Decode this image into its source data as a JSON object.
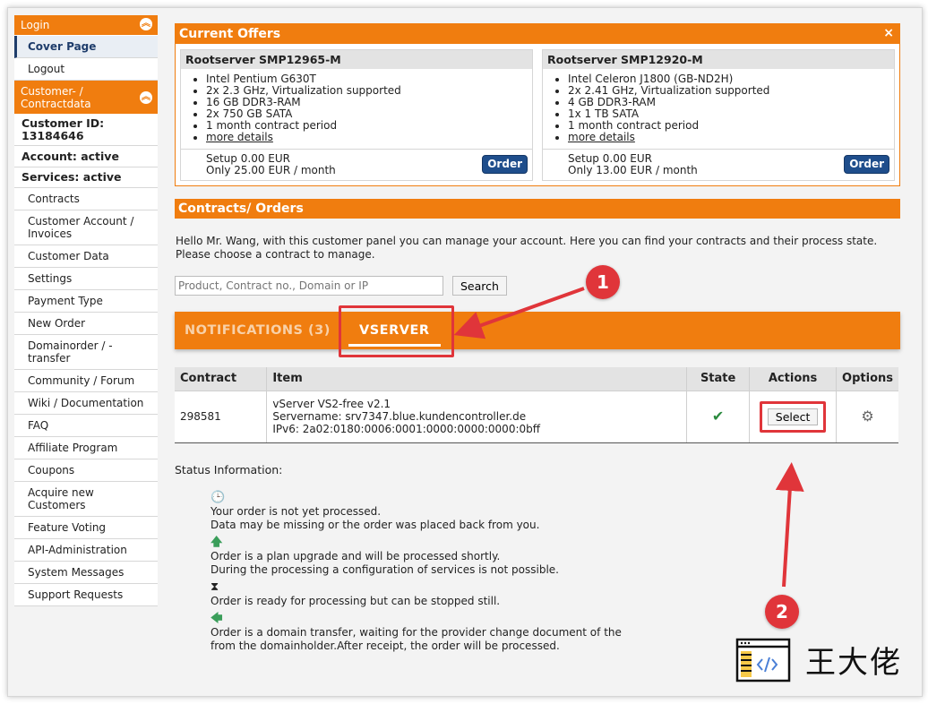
{
  "sidebar": {
    "login_label": "Login",
    "login_items": [
      "Cover Page",
      "Logout"
    ],
    "customer_heading_line1": "Customer- /",
    "customer_heading_line2": "Contractdata",
    "customer_id_label": "Customer ID:",
    "customer_id": "13184646",
    "account_status": "Account: active",
    "services_status": "Services: active",
    "menu": [
      "Contracts",
      "Customer Account / Invoices",
      "Customer Data",
      "Settings",
      "Payment Type",
      "New Order",
      "Domainorder / - transfer",
      "Community / Forum",
      "Wiki / Documentation",
      "FAQ",
      "Affiliate Program",
      "Coupons",
      "Acquire new Customers",
      "Feature Voting",
      "API-Administration",
      "System Messages",
      "Support Requests"
    ]
  },
  "offers": {
    "title": "Current Offers",
    "close_icon": "×",
    "items": [
      {
        "name": "Rootserver SMP12965-M",
        "features": [
          "Intel Pentium G630T",
          "2x 2.3 GHz, Virtualization supported",
          "16 GB DDR3-RAM",
          "2x 750 GB SATA",
          "1 month contract period"
        ],
        "more": "more details",
        "setup": "Setup 0.00 EUR",
        "price": "Only 25.00 EUR / month",
        "order_label": "Order"
      },
      {
        "name": "Rootserver SMP12920-M",
        "features": [
          "Intel Celeron J1800 (GB-ND2H)",
          "2x 2.41 GHz, Virtualization supported",
          "4 GB DDR3-RAM",
          "1x 1 TB SATA",
          "1 month contract period"
        ],
        "more": "more details",
        "setup": "Setup 0.00 EUR",
        "price": "Only 13.00 EUR / month",
        "order_label": "Order"
      }
    ]
  },
  "contracts_section": {
    "title": "Contracts/ Orders",
    "intro": "Hello Mr. Wang, with this customer panel you can manage your account. Here you can find your contracts and their process state. Please choose a contract to manage.",
    "search_placeholder": "Product, Contract no., Domain or IP",
    "search_button": "Search",
    "tab_notifications": "NOTIFICATIONS (3)",
    "tab_vserver": "VSERVER"
  },
  "table": {
    "headers": [
      "Contract",
      "Item",
      "State",
      "Actions",
      "Options"
    ],
    "row": {
      "contract": "298581",
      "item_line1": "vServer VS2-free v2.1",
      "item_line2": "Servername: srv7347.blue.kundencontroller.de",
      "item_line3": "IPv6: 2a02:0180:0006:0001:0000:0000:0000:0bff",
      "state_icon": "✔",
      "action_label": "Select",
      "options_icon": "⚙"
    }
  },
  "status": {
    "heading": "Status Information:",
    "items": [
      {
        "icon": "clock-icon",
        "glyph": "🕒",
        "line1": "Your order is not yet processed.",
        "line2": "Data may be missing or the order was placed back from you."
      },
      {
        "icon": "arrow-up-icon",
        "glyph": "🡅",
        "line1": "Order is a plan upgrade and will be processed shortly.",
        "line2": "During the processing a configuration of services is not possible."
      },
      {
        "icon": "hourglass-icon",
        "glyph": "⧗",
        "line1": "Order is ready for processing but can be stopped still.",
        "line2": ""
      },
      {
        "icon": "arrow-left-icon",
        "glyph": "🡄",
        "line1": "Order is a domain transfer, waiting for the provider change document of the",
        "line2": "from the domainholder.After receipt, the order will be processed."
      }
    ]
  },
  "annotations": {
    "badge1": "1",
    "badge2": "2",
    "watermark": "王大佬",
    "highlight_color": "#e0353a"
  },
  "colors": {
    "accent": "#f07d0f",
    "button_blue": "#1f4e8c"
  }
}
